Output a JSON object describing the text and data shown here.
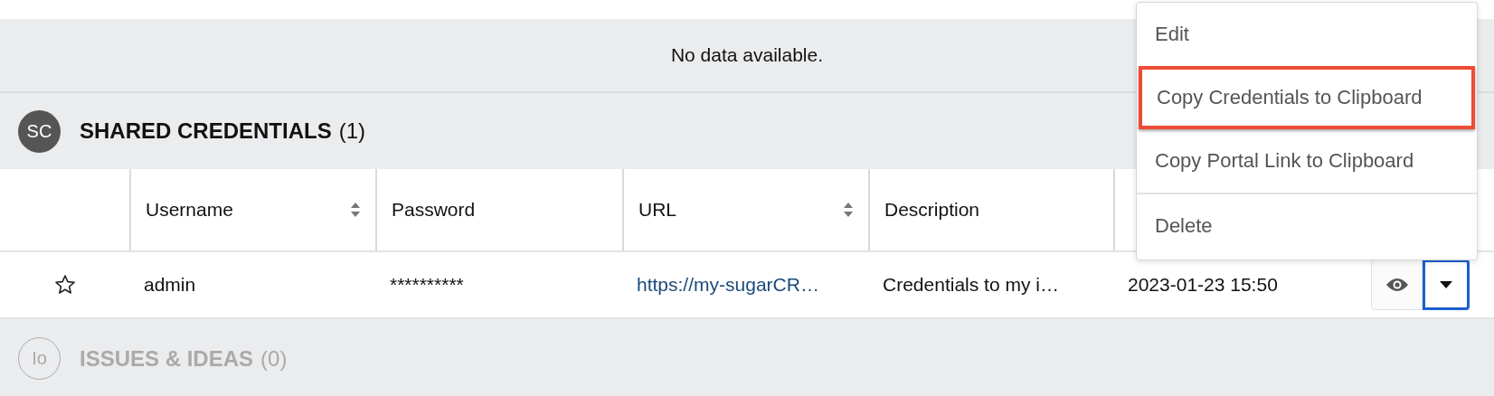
{
  "empty_panel": {
    "message": "No data available."
  },
  "sections": [
    {
      "badge": "SC",
      "title": "SHARED CREDENTIALS",
      "count": "(1)",
      "disabled": false,
      "table": {
        "columns": [
          {
            "label": "Username",
            "sortable": true
          },
          {
            "label": "Password",
            "sortable": false
          },
          {
            "label": "URL",
            "sortable": true
          },
          {
            "label": "Description",
            "sortable": false
          }
        ],
        "rows": [
          {
            "favorite": false,
            "cells": [
              {
                "text": "admin",
                "kind": "text"
              },
              {
                "text": "**********",
                "kind": "text"
              },
              {
                "text": "https://my-sugarCR…",
                "kind": "link"
              },
              {
                "text": "Credentials to my i…",
                "kind": "text"
              },
              {
                "text": "2023-01-23 15:50",
                "kind": "text"
              }
            ]
          }
        ]
      }
    },
    {
      "badge": "Io",
      "title": "ISSUES & IDEAS",
      "count": "(0)",
      "disabled": true
    }
  ],
  "action_menu": {
    "items": [
      {
        "label": "Edit",
        "selected": false,
        "divider_before": false
      },
      {
        "label": "Copy Credentials to Clipboard",
        "selected": true,
        "divider_before": false
      },
      {
        "label": "Copy Portal Link to Clipboard",
        "selected": false,
        "divider_before": false
      },
      {
        "label": "Delete",
        "selected": false,
        "divider_before": true
      }
    ]
  },
  "row_actions": {
    "dropdown_open": true
  }
}
